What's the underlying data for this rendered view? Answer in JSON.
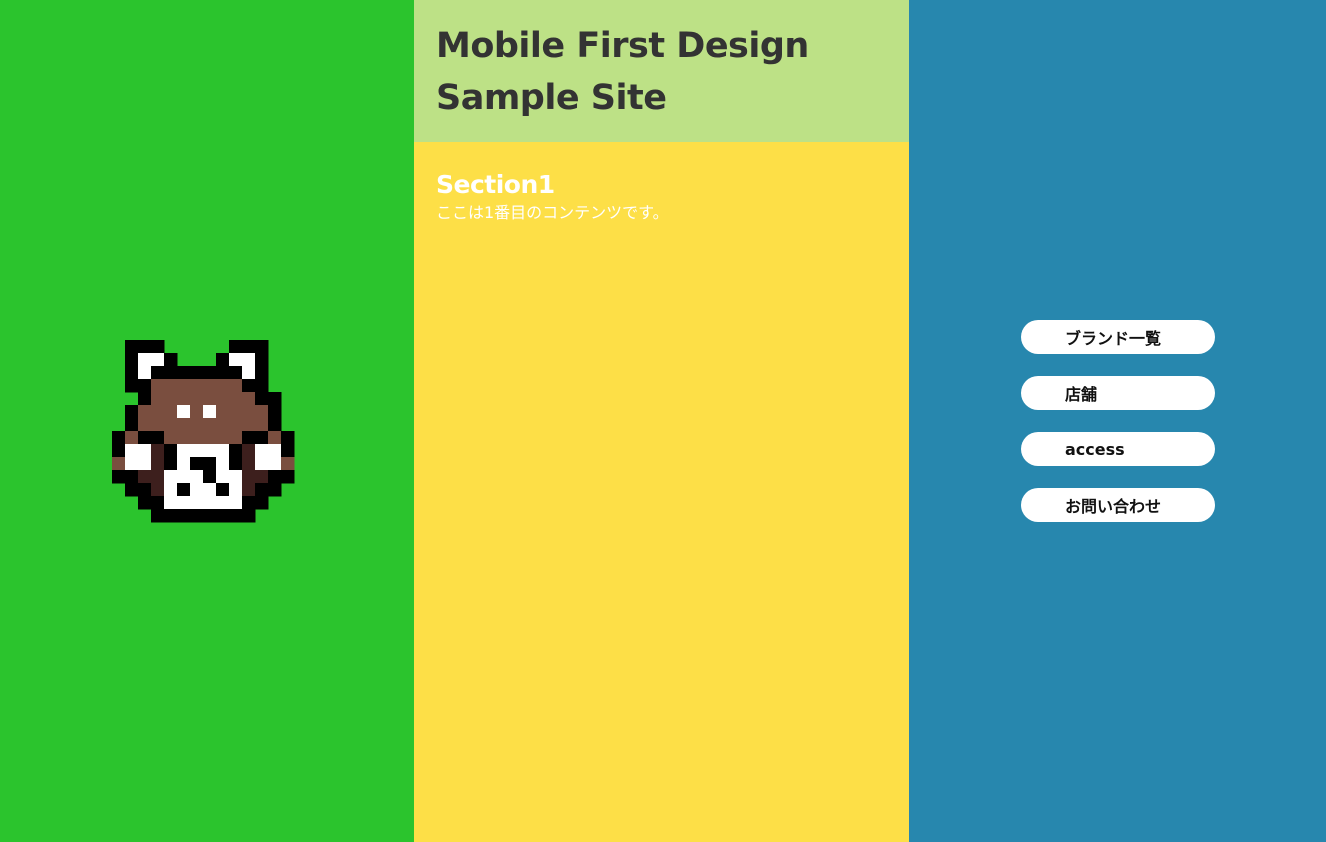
{
  "colors": {
    "left_bg": "#2bc42d",
    "header_bg": "#bde186",
    "main_bg": "#fddf47",
    "right_bg": "#2787ae",
    "title_text": "#333333",
    "section_text": "#ffffff",
    "nav_button_bg": "#ffffff"
  },
  "mascot": {
    "icon": "red-panda-pixel-icon"
  },
  "header": {
    "title_line1": "Mobile First Design",
    "title_line2": "Sample Site"
  },
  "section1": {
    "title": "Section1",
    "text": "ここは1番目のコンテンツです。"
  },
  "nav": {
    "items": [
      {
        "label": "ブランド一覧"
      },
      {
        "label": "店舗"
      },
      {
        "label": "access"
      },
      {
        "label": "お問い合わせ"
      }
    ]
  }
}
